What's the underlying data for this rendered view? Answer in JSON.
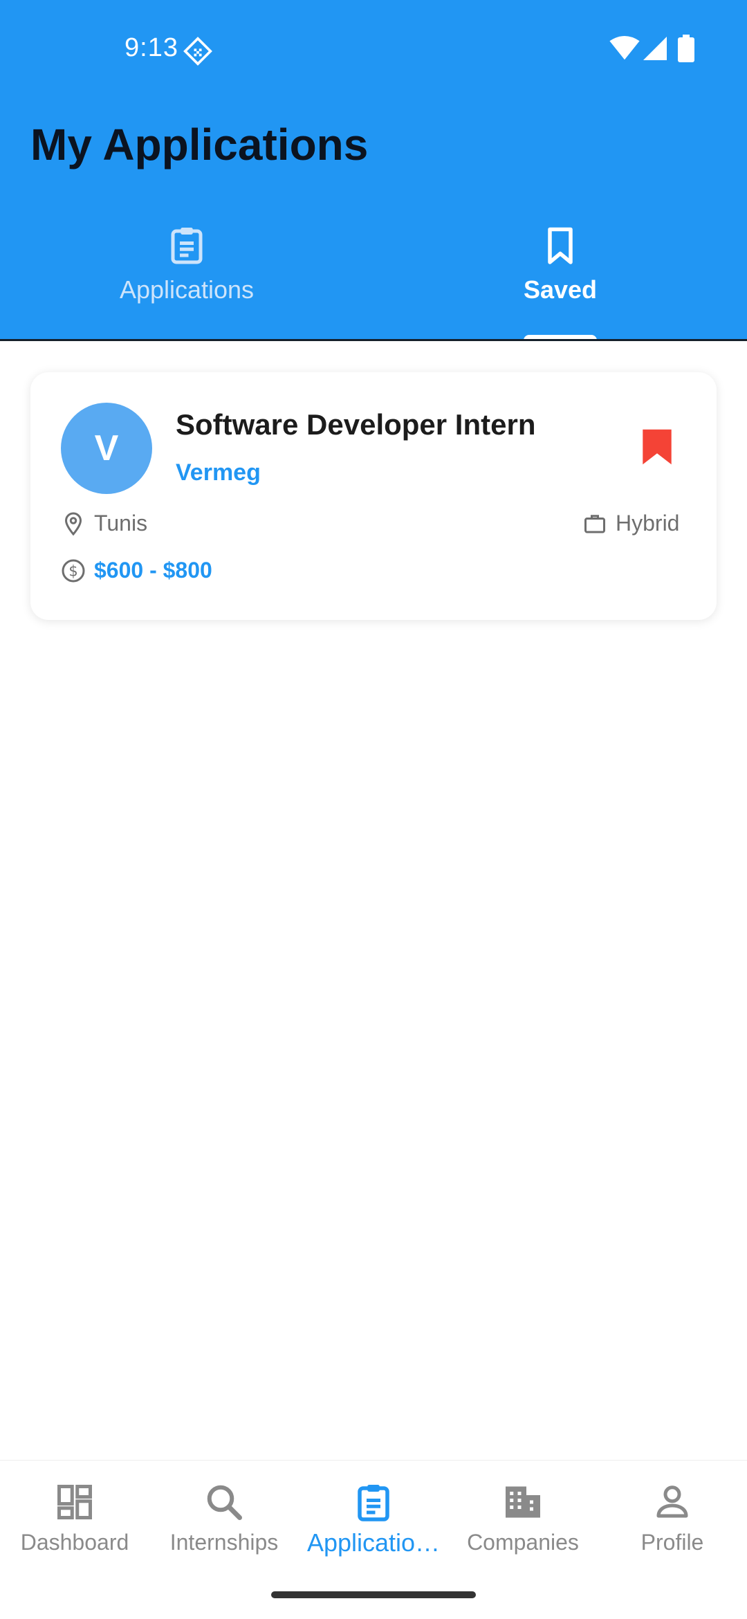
{
  "status_bar": {
    "time": "9:13",
    "icons": [
      "sim-diamond-icon",
      "wifi-icon",
      "cell-signal-icon",
      "battery-icon"
    ]
  },
  "header": {
    "title": "My Applications",
    "background_color": "#2196F3"
  },
  "tabs": [
    {
      "label": "Applications",
      "icon": "clipboard-list-icon",
      "active": false
    },
    {
      "label": "Saved",
      "icon": "bookmark-outline-icon",
      "active": true
    }
  ],
  "saved_items": [
    {
      "avatar_letter": "V",
      "title": "Software Developer Intern",
      "company": "Vermeg",
      "location": "Tunis",
      "work_type": "Hybrid",
      "salary": "$600 - $800",
      "bookmarked": true,
      "bookmark_color": "#F44336"
    }
  ],
  "bottom_nav": {
    "items": [
      {
        "label": "Dashboard",
        "icon": "dashboard-icon",
        "active": false
      },
      {
        "label": "Internships",
        "icon": "search-icon",
        "active": false
      },
      {
        "label": "Applicatio…",
        "icon": "clipboard-list-icon",
        "active": true
      },
      {
        "label": "Companies",
        "icon": "building-icon",
        "active": false
      },
      {
        "label": "Profile",
        "icon": "person-icon",
        "active": false
      }
    ],
    "accent_color": "#2196F3"
  }
}
